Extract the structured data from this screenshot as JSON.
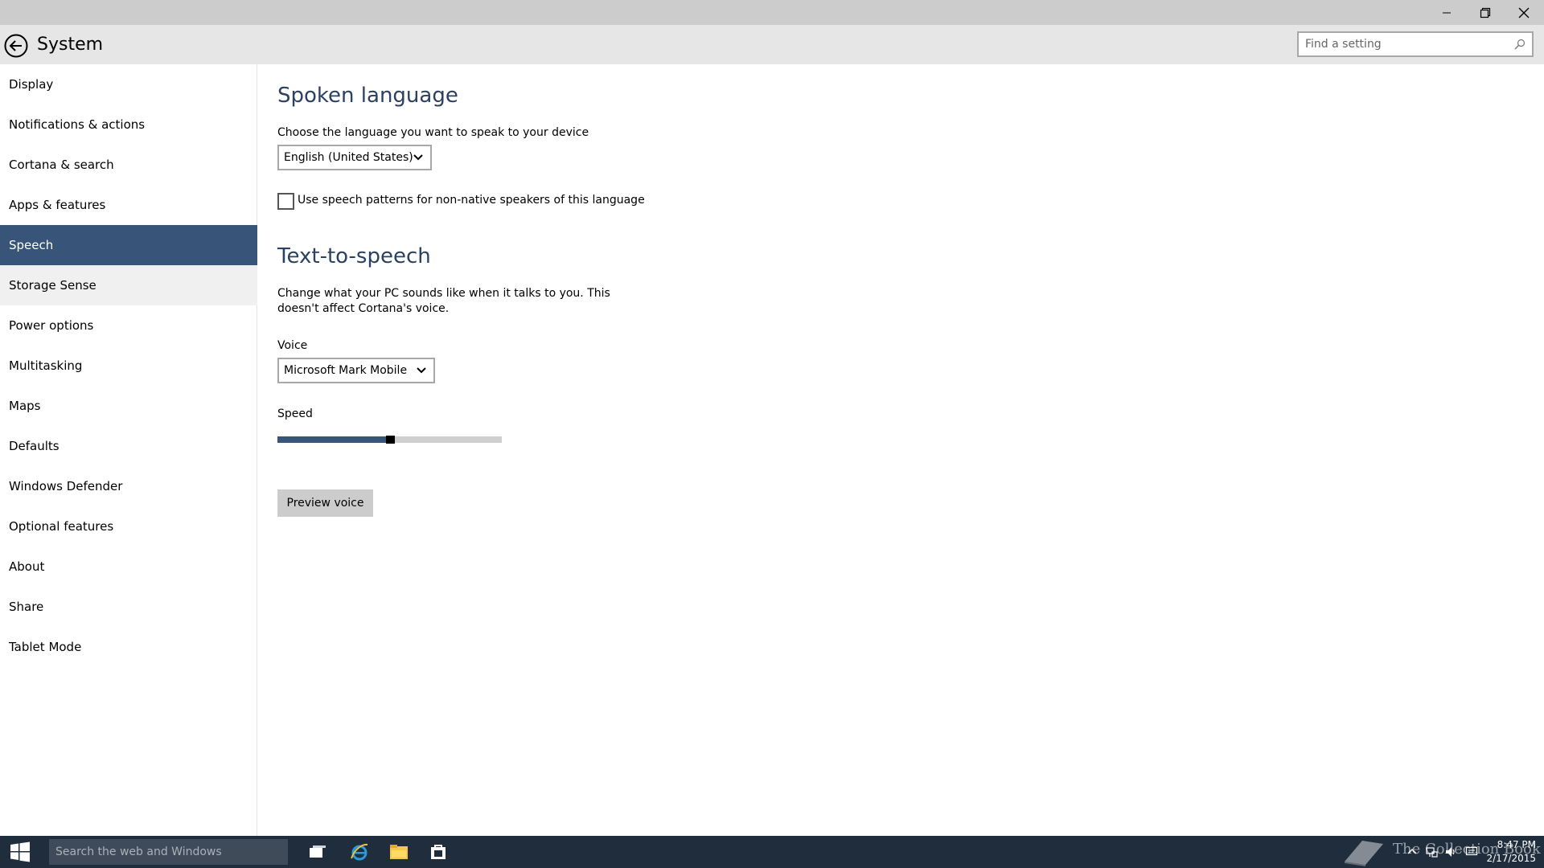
{
  "window": {
    "title_icons": [
      "minimize-icon",
      "restore-icon",
      "close-icon"
    ]
  },
  "header": {
    "title": "System",
    "search": {
      "placeholder": "Find a setting",
      "value": ""
    }
  },
  "sidebar": {
    "selected": "Speech",
    "items": [
      {
        "label": "Display"
      },
      {
        "label": "Notifications & actions"
      },
      {
        "label": "Cortana & search"
      },
      {
        "label": "Apps & features"
      },
      {
        "label": "Speech"
      },
      {
        "label": "Storage Sense"
      },
      {
        "label": "Power options"
      },
      {
        "label": "Multitasking"
      },
      {
        "label": "Maps"
      },
      {
        "label": "Defaults"
      },
      {
        "label": "Windows Defender"
      },
      {
        "label": "Optional features"
      },
      {
        "label": "About"
      },
      {
        "label": "Share"
      },
      {
        "label": "Tablet Mode"
      }
    ]
  },
  "content": {
    "spoken_language": {
      "title": "Spoken language",
      "prompt": "Choose the language you want to speak to your device",
      "language_value": "English (United States)",
      "checkbox_label": "Use speech patterns for non-native speakers of this language",
      "checkbox_checked": false
    },
    "tts": {
      "title": "Text-to-speech",
      "description": "Change what your PC sounds like when it talks to you. This doesn't affect Cortana's voice.",
      "voice_label": "Voice",
      "voice_value": "Microsoft Mark Mobile",
      "speed_label": "Speed",
      "speed_fraction": 0.5,
      "preview_button": "Preview voice"
    }
  },
  "taskbar": {
    "search_placeholder": "Search the web and Windows",
    "apps": [
      "task-view-icon",
      "internet-explorer-icon",
      "file-explorer-icon",
      "store-icon"
    ],
    "watermark": "The Collection Book",
    "clock_time": "8:47 PM",
    "clock_date": "2/17/2015"
  },
  "colors": {
    "accent": "#385579",
    "titlebar": "#cccccc",
    "header": "#e6e6e6",
    "taskbar": "#1f2d3d",
    "section_title": "#2b4162"
  }
}
